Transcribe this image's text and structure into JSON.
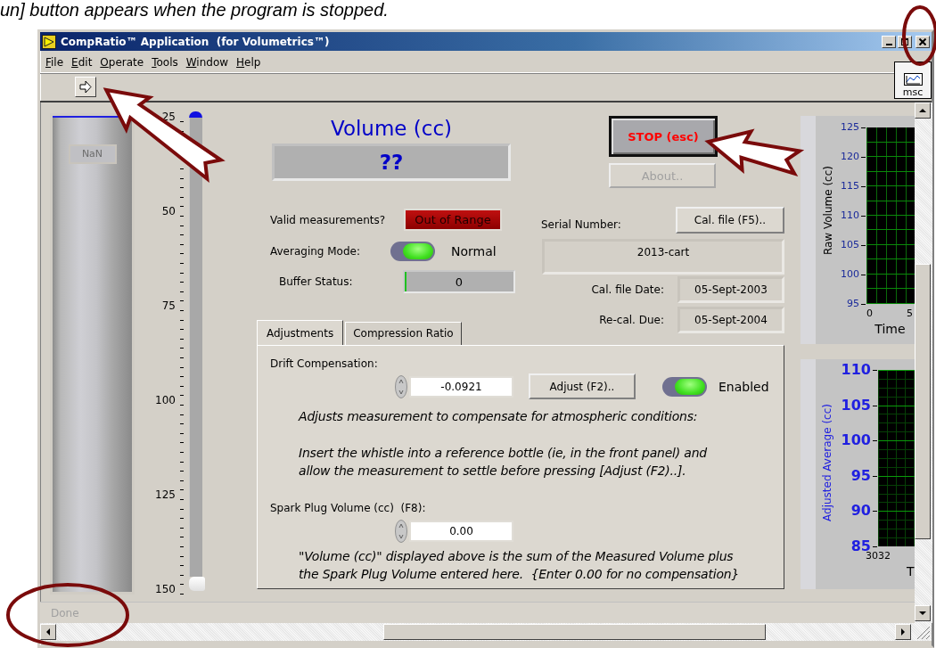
{
  "caption": "un] button appears when the program is stopped.",
  "window": {
    "title": "CompRatio™ Application  (for Volumetrics™)"
  },
  "menu": [
    {
      "label": "File"
    },
    {
      "label": "Edit"
    },
    {
      "label": "Operate"
    },
    {
      "label": "Tools"
    },
    {
      "label": "Window"
    },
    {
      "label": "Help"
    }
  ],
  "vi_icon": {
    "label": "msc"
  },
  "thermometer": {
    "readout": "NaN"
  },
  "slider": {
    "ticks": [
      "25",
      "50",
      "75",
      "100",
      "125",
      "150"
    ]
  },
  "volume": {
    "label": "Volume (cc)",
    "value": "??"
  },
  "stop_button": {
    "label": "STOP (esc)"
  },
  "about_button": {
    "label": "About..",
    "disabled": true
  },
  "valid": {
    "label": "Valid measurements?",
    "value": "Out of Range"
  },
  "averaging": {
    "label": "Averaging Mode:",
    "on": true,
    "state_label": "Normal"
  },
  "buffer": {
    "label": "Buffer Status:",
    "level": 0.02,
    "value": "0"
  },
  "serial": {
    "label": "Serial Number:",
    "value": "2013-cart"
  },
  "cal_button": {
    "label": "Cal. file (F5).."
  },
  "cal_date": {
    "label": "Cal. file Date:",
    "value": "05-Sept-2003"
  },
  "recal_due": {
    "label": "Re-cal. Due:",
    "value": "05-Sept-2004"
  },
  "tabs": [
    {
      "label": "Adjustments",
      "selected": true
    },
    {
      "label": "Compression Ratio",
      "selected": false
    }
  ],
  "drift": {
    "label": "Drift Compensation:",
    "value": "-0.0921",
    "button": "Adjust (F2)..",
    "enabled": true,
    "enabled_label": "Enabled",
    "note": "Adjusts measurement to compensate for atmospheric conditions:",
    "instructions": "Insert the whistle into a reference bottle (ie, in the front panel) and\nallow the measurement to settle before pressing [Adjust (F2)..]."
  },
  "spark": {
    "label": "Spark Plug Volume (cc)  (F8):",
    "value": "0.00",
    "note": "\"Volume (cc)\" displayed above is the sum of the Measured Volume plus\nthe Spark Plug Volume entered here.  {Enter 0.00 for no compensation}"
  },
  "raw_chart": {
    "ylabel": "Raw Volume (cc)",
    "yticks": [
      "125",
      "120",
      "115",
      "110",
      "105",
      "100",
      "95"
    ],
    "xticks": [
      "0",
      "5"
    ],
    "xlabel": "Time"
  },
  "avg_chart": {
    "ylabel": "Adjusted Average (cc)",
    "yticks": [
      "110",
      "105",
      "100",
      "95",
      "90",
      "85"
    ],
    "xticks": [
      "3032"
    ],
    "xlabel": "T"
  },
  "status_bar": {
    "text": "Done"
  }
}
